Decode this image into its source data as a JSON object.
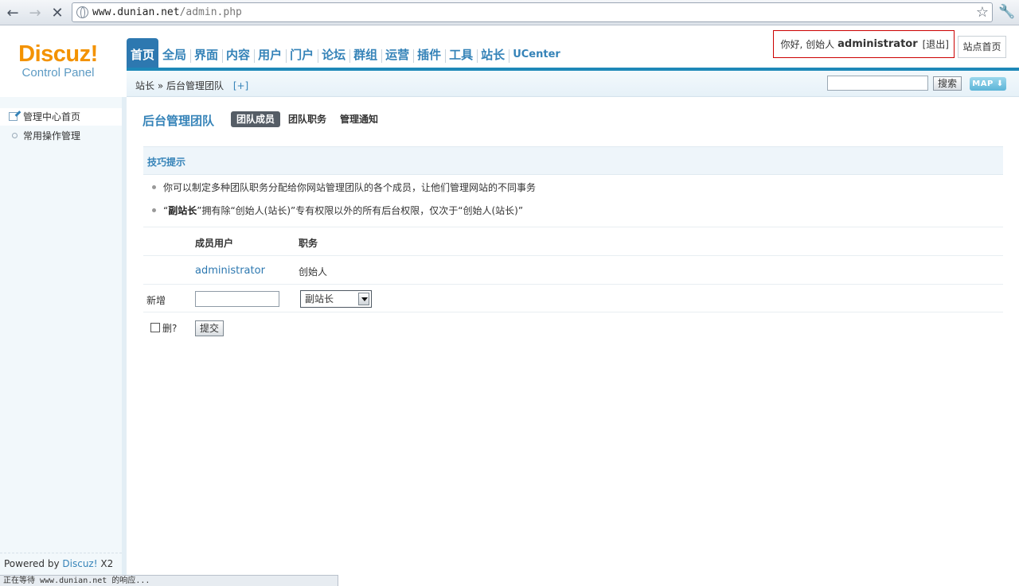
{
  "browser": {
    "url_host": "www.dunian.net",
    "url_path": "/admin.php",
    "back_glyph": "←",
    "forward_glyph": "→",
    "stop_glyph": "✕",
    "star_glyph": "☆",
    "wrench_glyph": "🔧",
    "status_text": "正在等待 www.dunian.net 的响应..."
  },
  "logo": {
    "main": "Discuz!",
    "sub": "Control Panel"
  },
  "nav": {
    "items": [
      "首页",
      "全局",
      "界面",
      "内容",
      "用户",
      "门户",
      "论坛",
      "群组",
      "运营",
      "插件",
      "工具",
      "站长",
      "UCenter"
    ]
  },
  "user": {
    "greeting": "你好, 创始人",
    "name": "administrator",
    "logout": "[退出]",
    "site_home": "站点首页"
  },
  "breadcrumb": {
    "path": "站长 » 后台管理团队",
    "plus": "[+]"
  },
  "search": {
    "value": "",
    "button": "搜索",
    "map": "MAP ⬇"
  },
  "sidebar": {
    "items": [
      {
        "label": "管理中心首页"
      },
      {
        "label": "常用操作管理"
      }
    ],
    "powered_prefix": "Powered by",
    "powered_brand": "Discuz!",
    "powered_version": "X2"
  },
  "content": {
    "title": "后台管理团队",
    "tabs": [
      "团队成员",
      "团队职务",
      "管理通知"
    ],
    "tips_title": "技巧提示",
    "tip1": "你可以制定多种团队职务分配给你网站管理团队的各个成员，让他们管理网站的不同事务",
    "tip2_bold": "副站长",
    "tip2_rest": "”拥有除“创始人(站长)”专有权限以外的所有后台权限，仅次于“创始人(站长)”",
    "tip2_open": "“",
    "table": {
      "col_user": "成员用户",
      "col_role": "职务",
      "rows": [
        {
          "user": "administrator",
          "role": "创始人"
        }
      ],
      "new_label": "新增",
      "new_user_value": "",
      "new_role_selected": "副站长"
    },
    "delete_label": "删?",
    "submit_label": "提交"
  }
}
